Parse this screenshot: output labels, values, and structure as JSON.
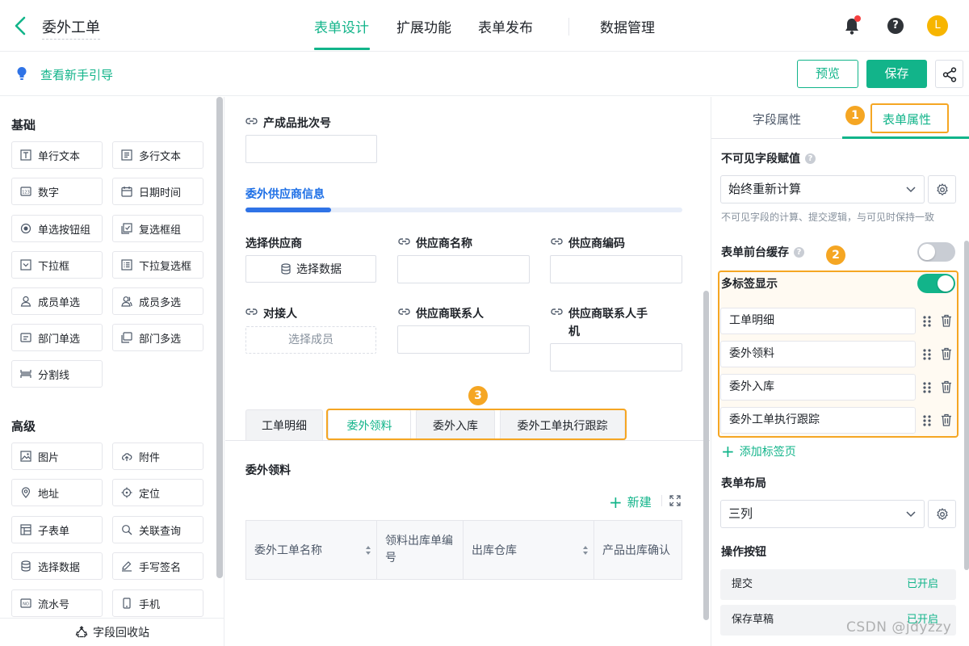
{
  "header": {
    "title": "委外工单",
    "tabs": [
      {
        "label": "表单设计",
        "active": true
      },
      {
        "label": "扩展功能",
        "active": false
      },
      {
        "label": "表单发布",
        "active": false
      },
      {
        "label": "数据管理",
        "active": false
      }
    ],
    "avatar_initial": "L",
    "accent_color": "#12b48a"
  },
  "subbar": {
    "guide_link": "查看新手引导",
    "preview_label": "预览",
    "save_label": "保存"
  },
  "left_panel": {
    "basic_title": "基础",
    "basic_fields": [
      "单行文本",
      "多行文本",
      "数字",
      "日期时间",
      "单选按钮组",
      "复选框组",
      "下拉框",
      "下拉复选框",
      "成员单选",
      "成员多选",
      "部门单选",
      "部门多选",
      "分割线"
    ],
    "advanced_title": "高级",
    "advanced_fields": [
      "图片",
      "附件",
      "地址",
      "定位",
      "子表单",
      "关联查询",
      "选择数据",
      "手写签名",
      "流水号",
      "手机"
    ],
    "recycle_label": "字段回收站"
  },
  "canvas": {
    "batch_label": "产成品批次号",
    "group_title": "委外供应商信息",
    "fields": {
      "select_supplier": "选择供应商",
      "select_data_btn": "选择数据",
      "supplier_name": "供应商名称",
      "supplier_code": "供应商编码",
      "contact": "对接人",
      "select_member": "选择成员",
      "supplier_contact": "供应商联系人",
      "supplier_phone_line1": "供应商联系人手",
      "supplier_phone_line2": "机"
    },
    "tabs": [
      {
        "label": "工单明细",
        "active": false
      },
      {
        "label": "委外领料",
        "active": true
      },
      {
        "label": "委外入库",
        "active": false
      },
      {
        "label": "委外工单执行跟踪",
        "active": false
      }
    ],
    "marker3": "3",
    "subtable_title": "委外领料",
    "new_label": "新建",
    "columns": [
      "委外工单名称",
      "领料出库单编号",
      "出库仓库",
      "产品出库确认"
    ]
  },
  "right_panel": {
    "tabs": [
      {
        "label": "字段属性",
        "active": false
      },
      {
        "label": "表单属性",
        "active": true
      }
    ],
    "marker1": "1",
    "marker2": "2",
    "invisible_title": "不可见字段赋值",
    "invisible_value": "始终重新计算",
    "invisible_hint": "不可见字段的计算、提交逻辑，与可见时保持一致",
    "cache_title": "表单前台缓存",
    "cache_on": false,
    "multitab_title": "多标签显示",
    "multitab_on": true,
    "tab_items": [
      "工单明细",
      "委外领料",
      "委外入库",
      "委外工单执行跟踪"
    ],
    "add_tab": "添加标签页",
    "layout_title": "表单布局",
    "layout_value": "三列",
    "op_title": "操作按钮",
    "ops": [
      {
        "label": "提交",
        "status": "已开启"
      },
      {
        "label": "保存草稿",
        "status": "已开启"
      }
    ]
  },
  "watermark": "CSDN @jdyzzy",
  "highlight_color": "#f5a623"
}
